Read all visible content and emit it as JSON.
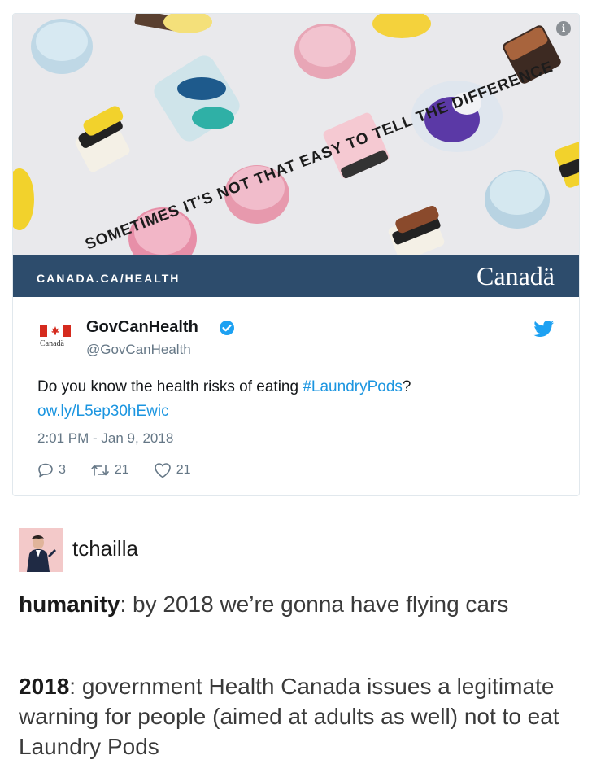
{
  "ad": {
    "banner_text": "SOMETIMES IT'S NOT THAT EASY TO TELL THE DIFFERENCE",
    "info_icon": "info-icon",
    "footer_url": "CANADA.CA/HEALTH",
    "footer_brand": "Canadä",
    "colors": {
      "footer": "#2d4c6c",
      "background": "#e9e9ec"
    }
  },
  "tweet": {
    "flag_caption": "Canadä",
    "display_name": "GovCanHealth",
    "handle": "@GovCanHealth",
    "text_before": "Do you know the health risks of eating ",
    "hashtag": "#LaundryPods",
    "text_after": "?",
    "link": "ow.ly/L5ep30hEwic",
    "timestamp": "2:01 PM - Jan 9, 2018",
    "replies": "3",
    "retweets": "21",
    "likes": "21",
    "colors": {
      "link": "#1b95e0",
      "verified": "#1da1f2"
    }
  },
  "post": {
    "username": "tchailla",
    "p1_bold": "humanity",
    "p1_rest": ": by 2018 we’re gonna have flying cars",
    "p2_bold": "2018",
    "p2_rest": ": government Health Canada issues a legitimate warning for people (aimed at adults as well) not to eat Laundry Pods"
  }
}
